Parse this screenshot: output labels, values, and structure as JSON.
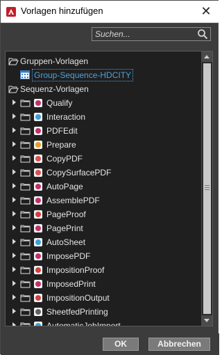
{
  "window": {
    "title": "Vorlagen hinzufügen"
  },
  "search": {
    "placeholder": "Suchen..."
  },
  "tree": {
    "group_label": "Gruppen-Vorlagen",
    "group_items": [
      "Group-Sequence-HDCITY"
    ],
    "sequence_label": "Sequenz-Vorlagen",
    "sequence_items": [
      {
        "label": "Qualify",
        "icon": "qualify-icon",
        "color": "#c0306a"
      },
      {
        "label": "Interaction",
        "icon": "interaction-icon",
        "color": "#3aa0d8"
      },
      {
        "label": "PDFEdit",
        "icon": "pdfedit-icon",
        "color": "#c0306a"
      },
      {
        "label": "Prepare",
        "icon": "prepare-icon",
        "color": "#e0a020"
      },
      {
        "label": "CopyPDF",
        "icon": "copypdf-icon",
        "color": "#d85050"
      },
      {
        "label": "CopySurfacePDF",
        "icon": "copysurfacepdf-icon",
        "color": "#d85050"
      },
      {
        "label": "AutoPage",
        "icon": "autopage-icon",
        "color": "#c0306a"
      },
      {
        "label": "AssemblePDF",
        "icon": "assemblepdf-icon",
        "color": "#c0306a"
      },
      {
        "label": "PageProof",
        "icon": "pageproof-icon",
        "color": "#d04040"
      },
      {
        "label": "PagePrint",
        "icon": "pageprint-icon",
        "color": "#c0306a"
      },
      {
        "label": "AutoSheet",
        "icon": "autosheet-icon",
        "color": "#3aa0d8"
      },
      {
        "label": "ImposePDF",
        "icon": "imposepdf-icon",
        "color": "#c0306a"
      },
      {
        "label": "ImpositionProof",
        "icon": "impositionproof-icon",
        "color": "#d04040"
      },
      {
        "label": "ImposedPrint",
        "icon": "imposedprint-icon",
        "color": "#c0306a"
      },
      {
        "label": "ImpositionOutput",
        "icon": "impositionoutput-icon",
        "color": "#d04040"
      },
      {
        "label": "SheetfedPrinting",
        "icon": "sheetfedprinting-icon",
        "color": "#606060"
      },
      {
        "label": "AutomaticJobImport",
        "icon": "automaticjobimport-icon",
        "color": "#3aa0d8"
      }
    ]
  },
  "buttons": {
    "ok": "OK",
    "cancel": "Abbrechen"
  },
  "colors": {
    "background": "#3c3c3c",
    "tree_bg": "#1f1f1f",
    "selection": "#4aa3e0"
  }
}
